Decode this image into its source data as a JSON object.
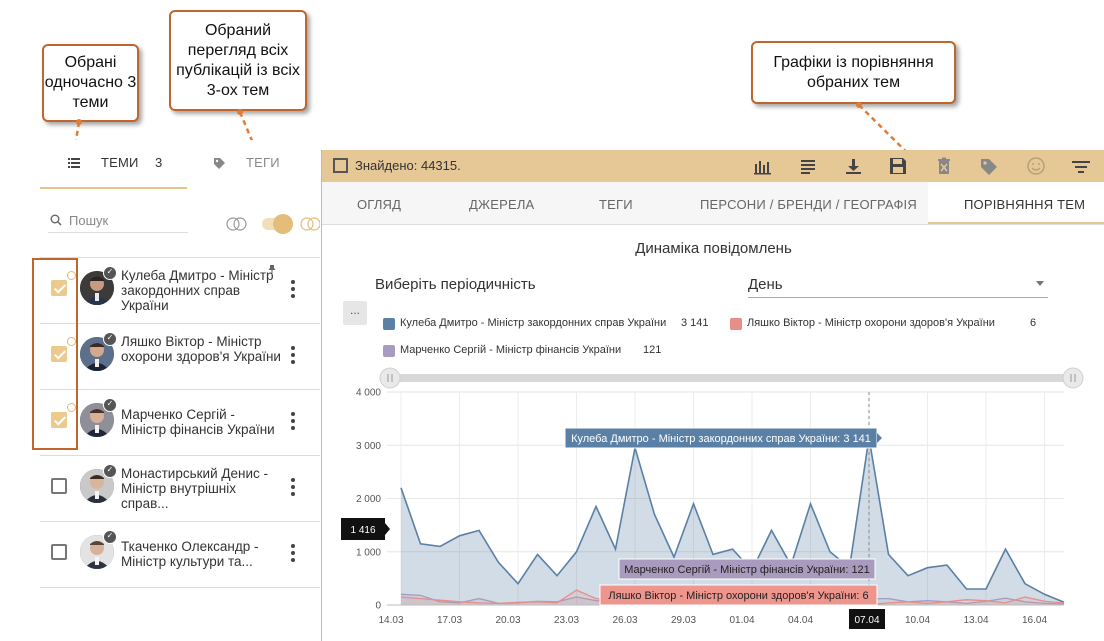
{
  "callouts": {
    "three_topics": "Обрані одночасно 3 теми",
    "all_publications": "Обраний перегляд всіх публікацій із всіх 3-ох тем",
    "comparison_charts": "Графіки із порівняння обраних тем"
  },
  "left_panel": {
    "tabs": {
      "topics_label": "ТЕМИ",
      "topics_count": "3",
      "tags_label": "ТЕГИ"
    },
    "search": {
      "placeholder": "Пошук"
    },
    "items": [
      {
        "name": "Кулеба Дмитро - Міністр закордонних справ України",
        "checked": true,
        "pinned": true
      },
      {
        "name": "Ляшко Віктор - Міністр охорони здоров'я України",
        "checked": true,
        "pinned": false
      },
      {
        "name": "Марченко Сергій - Міністр фінансів України",
        "checked": true,
        "pinned": false
      },
      {
        "name": "Монастирський Денис - Міністр внутрішніх справ...",
        "checked": false,
        "pinned": false
      },
      {
        "name": "Ткаченко Олександр - Міністр культури та...",
        "checked": false,
        "pinned": false
      }
    ]
  },
  "toolbar": {
    "found": "Знайдено: 44315.",
    "icons": [
      "bar-chart-icon",
      "list-icon",
      "download-icon",
      "save-icon",
      "delete-icon",
      "tag-icon",
      "smiley-icon",
      "filter-icon"
    ]
  },
  "tabs": [
    "ОГЛЯД",
    "ДЖЕРЕЛА",
    "ТЕГИ",
    "ПЕРСОНИ / БРЕНДИ / ГЕОГРАФІЯ",
    "ПОРІВНЯННЯ ТЕМ"
  ],
  "active_tab": "ПОРІВНЯННЯ ТЕМ",
  "periodicity": {
    "label": "Виберіть періодичність",
    "value": "День"
  },
  "more_button": "...",
  "colors": {
    "accent": "#e6c796",
    "callout_border": "#c0652b",
    "series1": "#5a80a6",
    "series2": "#e88e87",
    "series3": "#a99bbd"
  },
  "chart_data": {
    "type": "area",
    "title": "Динаміка повідомлень",
    "x": [
      "14.03",
      "15.03",
      "16.03",
      "17.03",
      "18.03",
      "19.03",
      "20.03",
      "21.03",
      "22.03",
      "23.03",
      "24.03",
      "25.03",
      "26.03",
      "27.03",
      "28.03",
      "29.03",
      "30.03",
      "31.03",
      "01.04",
      "02.04",
      "03.04",
      "04.04",
      "05.04",
      "06.04",
      "07.04",
      "08.04",
      "09.04",
      "10.04",
      "11.04",
      "12.04",
      "13.04",
      "14.04",
      "15.04",
      "16.04",
      "17.04"
    ],
    "xticks": [
      "14.03",
      "17.03",
      "20.03",
      "23.03",
      "26.03",
      "29.03",
      "01.04",
      "04.04",
      "07.04",
      "10.04",
      "13.04",
      "16.04"
    ],
    "ylim": [
      0,
      4000
    ],
    "yticks": [
      "0",
      "1 000",
      "2 000",
      "3 000",
      "4 000"
    ],
    "series": [
      {
        "name": "Кулеба Дмитро - Міністр закордонних справ України",
        "total": "3 141",
        "values": [
          2200,
          1150,
          1100,
          1300,
          1400,
          800,
          400,
          950,
          550,
          1000,
          1850,
          1050,
          2950,
          1700,
          900,
          1900,
          950,
          1050,
          650,
          1400,
          750,
          1900,
          1000,
          700,
          3141,
          950,
          550,
          700,
          750,
          300,
          300,
          1050,
          400,
          200,
          50
        ]
      },
      {
        "name": "Ляшко Віктор - Міністр охорони здоров'я України",
        "total": "6",
        "values": [
          150,
          120,
          90,
          60,
          40,
          30,
          50,
          60,
          40,
          280,
          120,
          90,
          60,
          40,
          60,
          50,
          40,
          60,
          70,
          40,
          50,
          100,
          60,
          40,
          6,
          40,
          60,
          30,
          60,
          100,
          80,
          40,
          150,
          70,
          40
        ]
      },
      {
        "name": "Марченко Сергій - Міністр фінансів України",
        "total": "121",
        "values": [
          200,
          180,
          60,
          40,
          120,
          30,
          40,
          70,
          60,
          150,
          80,
          60,
          300,
          250,
          200,
          50,
          80,
          160,
          120,
          60,
          90,
          170,
          200,
          100,
          121,
          120,
          60,
          80,
          60,
          30,
          70,
          130,
          60,
          30,
          20
        ]
      }
    ],
    "tooltips": {
      "series1": "Кулеба Дмитро - Міністр закордонних справ України: 3 141",
      "series3": "Марченко Сергій - Міністр фінансів України: 121",
      "series2": "Ляшко Віктор - Міністр охорони здоров'я України: 6"
    },
    "crosshair_y_label": "1 416",
    "crosshair_x_label": "07.04",
    "grid": true
  }
}
